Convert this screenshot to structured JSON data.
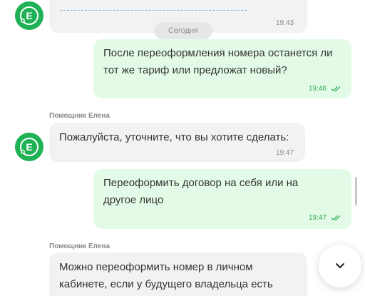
{
  "chat": {
    "date_separator": "Сегодня",
    "messages": [
      {
        "direction": "in",
        "time": "19:43"
      },
      {
        "direction": "out",
        "text": "После переоформления номера останется ли\nтот же тариф или предложат новый?",
        "time": "19:46"
      },
      {
        "direction": "in",
        "sender": "Помощник Елена",
        "text": "Пожалуйста, уточните, что вы хотите сделать:",
        "time": "19:47"
      },
      {
        "direction": "out",
        "text": "Переоформить договор на себя или на\nдругое лицо",
        "time": "19:47"
      },
      {
        "direction": "in",
        "sender": "Помощник Елена",
        "text": "Можно переоформить номер в личном\nкабинете, если у будущего владельца есть"
      }
    ],
    "avatar_letter": "E"
  },
  "icons": {
    "read_receipt": "double-check-icon",
    "scroll_down": "chevron-down-icon"
  },
  "colors": {
    "accent": "#1fb155",
    "outgoing_bubble": "#e3fbe6",
    "incoming_bubble": "#f2f2f2",
    "time_outgoing": "#2aaa52"
  }
}
